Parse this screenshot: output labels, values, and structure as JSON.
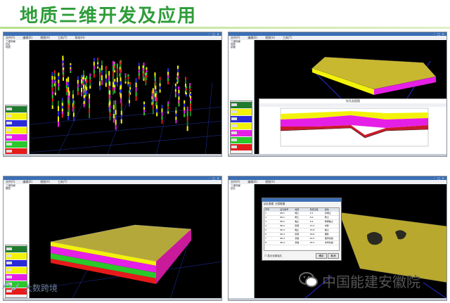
{
  "header": {
    "title": "地质三维开发及应用",
    "title_color": "#2e9c3a"
  },
  "menu": {
    "items": [
      "文件(F)",
      "编辑(E)",
      "视图(V)",
      "工具(T)",
      "帮助(H)"
    ]
  },
  "tree": {
    "nodes": [
      "三维场景",
      "钻孔",
      "地层",
      "剖面",
      "模型"
    ]
  },
  "legend_colors": [
    "#1e7a2c",
    "#f2f20a",
    "#2a2ad8",
    "#f2f20a",
    "#e61fe6",
    "#2ac82a",
    "#e61a1a"
  ],
  "profile_panel": {
    "title": "钻孔剖面图"
  },
  "dialog": {
    "tabs": [
      "钻孔数据",
      "分层数据"
    ],
    "columns": [
      "序号",
      "钻孔编号",
      "地层",
      "层底深度",
      "岩性"
    ],
    "rows": [
      [
        "1",
        "ZK-1",
        "填土",
        "2.5",
        "杂填土"
      ],
      [
        "2",
        "ZK-1",
        "粉土",
        "6.0",
        "粉土"
      ],
      [
        "3",
        "ZK-2",
        "黏土",
        "9.4",
        "粉质黏土"
      ],
      [
        "4",
        "ZK-2",
        "砂层",
        "13.2",
        "中砂"
      ],
      [
        "5",
        "ZK-3",
        "黏土",
        "15.8",
        "黏土"
      ],
      [
        "6",
        "ZK-3",
        "砂层",
        "18.6",
        "细砂"
      ],
      [
        "7",
        "ZK-4",
        "基岩",
        "22.0",
        "强风化岩"
      ],
      [
        "8",
        "ZK-4",
        "基岩",
        "25.5",
        "中风化岩"
      ]
    ],
    "checkbox_label": "显示全部钻孔",
    "ok_label": "确定",
    "cancel_label": "取消"
  },
  "watermark": {
    "text": "中国能建安徽院"
  },
  "logo": {
    "text": "大数跨境"
  }
}
